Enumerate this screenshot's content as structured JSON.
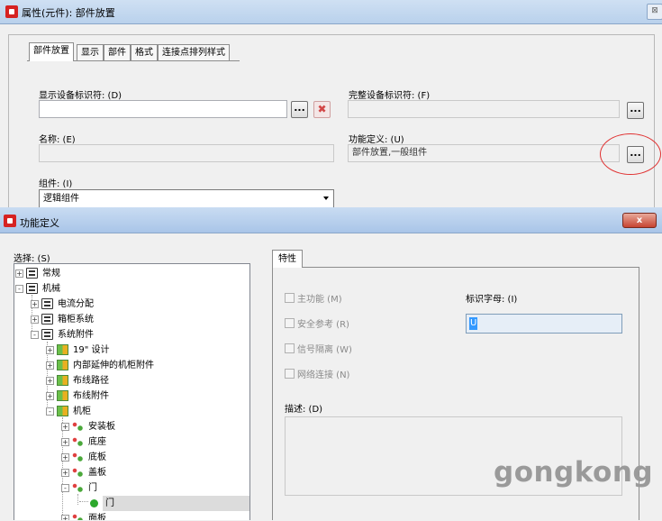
{
  "props_window": {
    "title": "属性(元件): 部件放置",
    "tabs": [
      "部件放置",
      "显示",
      "部件",
      "格式",
      "连接点排列样式"
    ],
    "display_id_label": "显示设备标识符: (D)",
    "display_id_value": "",
    "full_id_label": "完整设备标识符: (F)",
    "full_id_value": "",
    "name_label": "名称: (E)",
    "name_value": "",
    "func_def_label": "功能定义: (U)",
    "func_def_value": "部件放置,一般组件",
    "group_label": "组件: (I)",
    "group_value": "逻辑组件",
    "dots_button": "...",
    "delete_button": "✖"
  },
  "func_dialog": {
    "title": "功能定义",
    "close_button": "x",
    "select_label": "选择: (S)",
    "tree": [
      {
        "label": "常规",
        "level": 0,
        "icon": "folder",
        "expander": "+"
      },
      {
        "label": "机械",
        "level": 0,
        "icon": "folder",
        "expander": "-"
      },
      {
        "label": "电流分配",
        "level": 1,
        "icon": "folder",
        "expander": "+"
      },
      {
        "label": "箱柜系统",
        "level": 1,
        "icon": "folder",
        "expander": "+"
      },
      {
        "label": "系统附件",
        "level": 1,
        "icon": "folder",
        "expander": "-"
      },
      {
        "label": "19\" 设计",
        "level": 2,
        "icon": "part",
        "expander": "+"
      },
      {
        "label": "内部延伸的机柜附件",
        "level": 2,
        "icon": "part",
        "expander": "+"
      },
      {
        "label": "布线路径",
        "level": 2,
        "icon": "part",
        "expander": "+"
      },
      {
        "label": "布线附件",
        "level": 2,
        "icon": "part",
        "expander": "+"
      },
      {
        "label": "机柜",
        "level": 2,
        "icon": "part",
        "expander": "-"
      },
      {
        "label": "安装板",
        "level": 3,
        "icon": "sub",
        "expander": "+"
      },
      {
        "label": "底座",
        "level": 3,
        "icon": "sub",
        "expander": "+"
      },
      {
        "label": "底板",
        "level": 3,
        "icon": "sub",
        "expander": "+"
      },
      {
        "label": "盖板",
        "level": 3,
        "icon": "sub",
        "expander": "+"
      },
      {
        "label": "门",
        "level": 3,
        "icon": "sub",
        "expander": "-"
      },
      {
        "label": "门",
        "level": 4,
        "icon": "leaf",
        "expander": "",
        "selected": true
      },
      {
        "label": "面板",
        "level": 3,
        "icon": "sub",
        "expander": "+"
      }
    ],
    "properties_tab": "特性",
    "checkboxes": [
      "主功能 (M)",
      "安全参考 (R)",
      "信号隔离 (W)",
      "网络连接 (N)"
    ],
    "id_letter_label": "标识字母: (I)",
    "id_letter_value": "U",
    "description_label": "描述: (D)",
    "description_value": ""
  },
  "watermark": "gongkong",
  "colors": {
    "title_bar": "#b9d1ec",
    "close_button": "#c74431",
    "selection": "#3399ff",
    "annotation_ellipse": "#e03030"
  }
}
